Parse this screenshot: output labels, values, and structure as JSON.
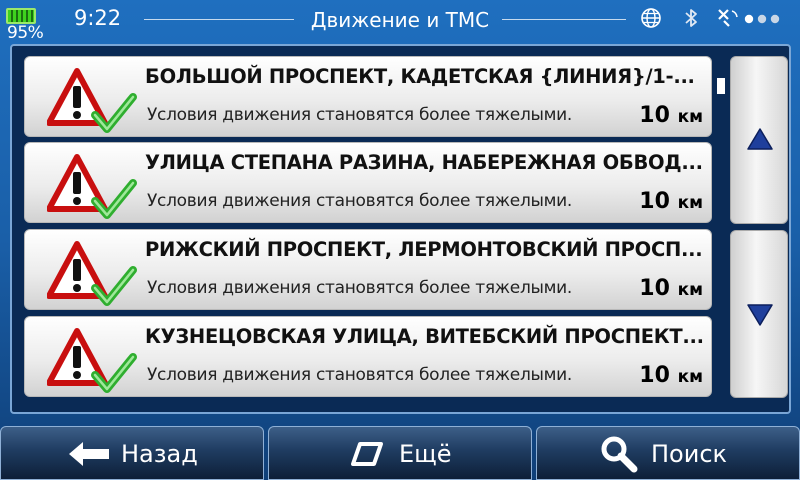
{
  "status": {
    "battery_percent": "95%",
    "time": "9:22",
    "title": "Движение и TMC",
    "icons": [
      "globe-icon",
      "bluetooth-icon",
      "satellite-icon",
      "gps-signal-dots-icon"
    ]
  },
  "traffic_list": [
    {
      "title": "БОЛЬШОЙ ПРОСПЕКТ, КАДЕТСКАЯ {ЛИНИЯ}/1-...",
      "description": "Условия движения становятся более тяжелыми.",
      "distance_value": "10",
      "distance_unit": "км",
      "icon": "warning-checkmark-icon"
    },
    {
      "title": "УЛИЦА СТЕПАНА РАЗИНА, НАБЕРЕЖНАЯ ОБВОД...",
      "description": "Условия движения становятся более тяжелыми.",
      "distance_value": "10",
      "distance_unit": "км",
      "icon": "warning-checkmark-icon"
    },
    {
      "title": "РИЖСКИЙ ПРОСПЕКТ, ЛЕРМОНТОВСКИЙ ПРОСП...",
      "description": "Условия движения становятся более тяжелыми.",
      "distance_value": "10",
      "distance_unit": "км",
      "icon": "warning-checkmark-icon"
    },
    {
      "title": "КУЗНЕЦОВСКАЯ УЛИЦА, ВИТЕБСКИЙ ПРОСПЕКТ...",
      "description": "Условия движения становятся более тяжелыми.",
      "distance_value": "10",
      "distance_unit": "км",
      "icon": "warning-checkmark-icon"
    }
  ],
  "scroll": {
    "up_icon": "arrow-up-icon",
    "down_icon": "arrow-down-icon"
  },
  "bottom_bar": {
    "back_label": "Назад",
    "more_label": "Ещё",
    "search_label": "Поиск"
  },
  "colors": {
    "background": "#1a5fa8",
    "panel": "#0a2a55",
    "warning_red": "#d01818",
    "check_green": "#2fae2f",
    "arrow_blue": "#1f3f9c"
  }
}
